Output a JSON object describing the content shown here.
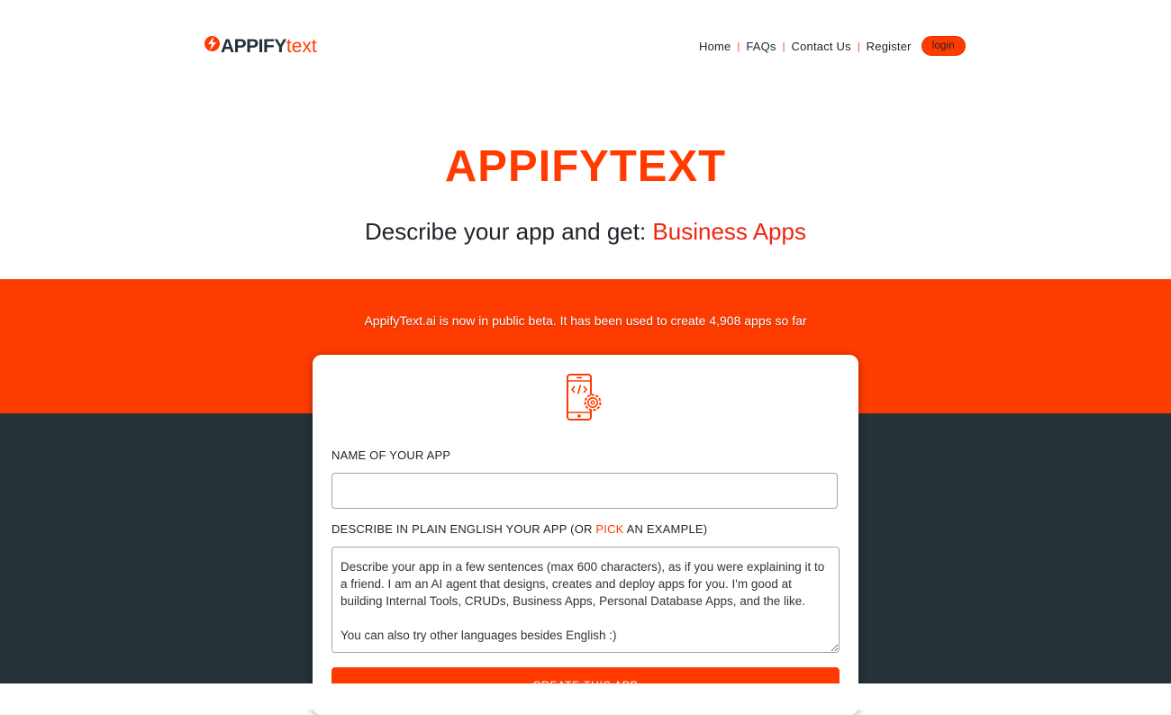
{
  "header": {
    "logo_bold": "APPIFY",
    "logo_light": "text",
    "nav": [
      "Home",
      "FAQs",
      "Contact Us",
      "Register"
    ],
    "separator": "|",
    "login_label": "login"
  },
  "hero": {
    "title": "APPIFYTEXT",
    "subtitle_prefix": "Describe your app and get: ",
    "subtitle_accent": "Business Apps"
  },
  "banner": {
    "beta_text": "AppifyText.ai is now in public beta. It has been used to create 4,908 apps so far"
  },
  "form": {
    "icon": "mobile-code-gear-icon",
    "name_label": "NAME OF YOUR APP",
    "name_value": "",
    "describe_label_prefix": "DESCRIBE IN PLAIN ENGLISH YOUR APP (OR ",
    "describe_label_link": "PICK",
    "describe_label_suffix": " AN EXAMPLE)",
    "describe_placeholder": "Describe your app in a few sentences (max 600 characters), as if you were explaining it to a friend. I am an AI agent that designs, creates and deploy apps for you. I'm good at building Internal Tools, CRUDs, Business Apps, Personal Database Apps, and the like.\n\nYou can also try other languages besides English :)",
    "create_label": "Create this app"
  },
  "colors": {
    "brand_orange": "#ff3c00",
    "dark_band": "#253237"
  }
}
